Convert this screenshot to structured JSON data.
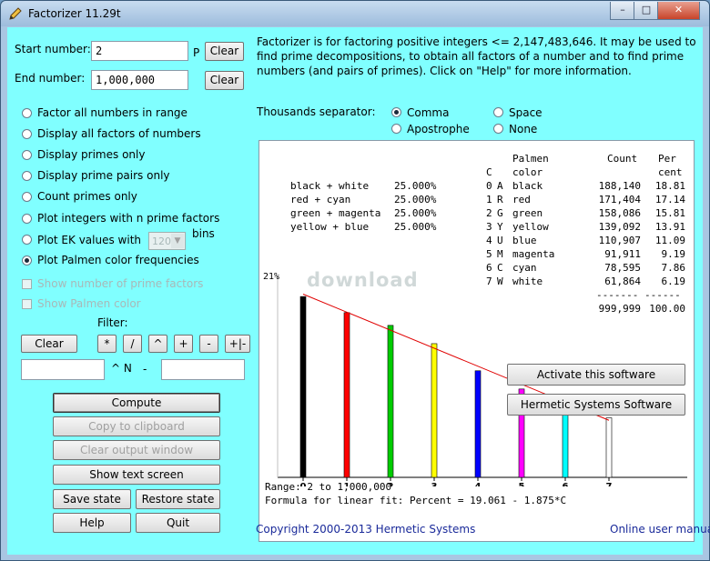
{
  "window": {
    "title": "Factorizer 11.29t",
    "minimize": "–",
    "maximize": "□",
    "close": "✕"
  },
  "inputs": {
    "start_label": "Start number:",
    "start_value": "2",
    "p_label": "P",
    "end_label": "End number:",
    "end_value": "1,000,000",
    "clear_label": "Clear"
  },
  "options": {
    "factor_all": "Factor all numbers in range",
    "display_factors": "Display all factors of numbers",
    "display_primes": "Display primes only",
    "display_prime_pairs": "Display prime pairs only",
    "count_primes": "Count primes only",
    "plot_integers": "Plot integers with n  prime factors",
    "plot_ek": "Plot EK values with",
    "ek_value": "120",
    "bins": "bins",
    "plot_palmen": "Plot Palmen color frequencies",
    "show_num_factors": "Show number of prime factors",
    "show_palmen": "Show Palmen color"
  },
  "filter": {
    "label": "Filter:",
    "clear": "Clear",
    "ops": [
      "*",
      "/",
      "^",
      "+",
      "-",
      "+|-"
    ],
    "caret_n": "^ N",
    "minus": "-"
  },
  "buttons": {
    "compute": "Compute",
    "copy": "Copy to clipboard",
    "clear_output": "Clear output window",
    "show_text": "Show text screen",
    "save": "Save state",
    "restore": "Restore state",
    "help": "Help",
    "quit": "Quit"
  },
  "info": "Factorizer is for factoring positive integers <= 2,147,483,646.  It may be used to find prime decompositions, to obtain all factors of a number and to find prime numbers (and pairs of primes).  Click on \"Help\" for more information.",
  "separator": {
    "label": "Thousands separator:",
    "comma": "Comma",
    "space": "Space",
    "apostrophe": "Apostrophe",
    "none": "None"
  },
  "output": {
    "pairs": [
      {
        "name": "black + white",
        "pct": "25.000%"
      },
      {
        "name": "red + cyan",
        "pct": "25.000%"
      },
      {
        "name": "green + magenta",
        "pct": "25.000%"
      },
      {
        "name": "yellow + blue",
        "pct": "25.000%"
      }
    ],
    "header_palmen": "Palmen",
    "header_c": "C",
    "header_color": "color",
    "header_count": "Count",
    "header_per": "Per",
    "header_cent": "cent",
    "rows": [
      {
        "c": "0",
        "k": "A",
        "color": "black",
        "count": "188,140",
        "pct": "18.81"
      },
      {
        "c": "1",
        "k": "R",
        "color": "red",
        "count": "171,404",
        "pct": "17.14"
      },
      {
        "c": "2",
        "k": "G",
        "color": "green",
        "count": "158,086",
        "pct": "15.81"
      },
      {
        "c": "3",
        "k": "Y",
        "color": "yellow",
        "count": "139,092",
        "pct": "13.91"
      },
      {
        "c": "4",
        "k": "U",
        "color": "blue",
        "count": "110,907",
        "pct": "11.09"
      },
      {
        "c": "5",
        "k": "M",
        "color": "magenta",
        "count": "91,911",
        "pct": "9.19"
      },
      {
        "c": "6",
        "k": "C",
        "color": "cyan",
        "count": "78,595",
        "pct": "7.86"
      },
      {
        "c": "7",
        "k": "W",
        "color": "white",
        "count": "61,864",
        "pct": "6.19"
      }
    ],
    "rule": "------- ------",
    "total_count": "999,999",
    "total_pct": "100.00",
    "watermark": "download",
    "range": "Range: 2 to 1,000,000",
    "formula": "Formula for linear fit: Percent = 19.061 - 1.875*C"
  },
  "chart_data": {
    "type": "bar",
    "categories": [
      "0",
      "1",
      "2",
      "3",
      "4",
      "5",
      "6",
      "7"
    ],
    "values": [
      18.81,
      17.14,
      15.81,
      13.91,
      11.09,
      9.19,
      7.86,
      6.19
    ],
    "colors": [
      "#000000",
      "#ff0000",
      "#00cc00",
      "#ffff00",
      "#0000ff",
      "#ff00ff",
      "#00ffff",
      "#ffffff"
    ],
    "ymax_label": "21%",
    "ylim": [
      0,
      21
    ],
    "fit": {
      "intercept": 19.061,
      "slope": -1.875
    }
  },
  "overlay": {
    "activate": "Activate this software",
    "hermetic": "Hermetic Systems Software"
  },
  "footer": {
    "copyright": "Copyright 2000-2013 Hermetic Systems",
    "manual": "Online user manual"
  }
}
